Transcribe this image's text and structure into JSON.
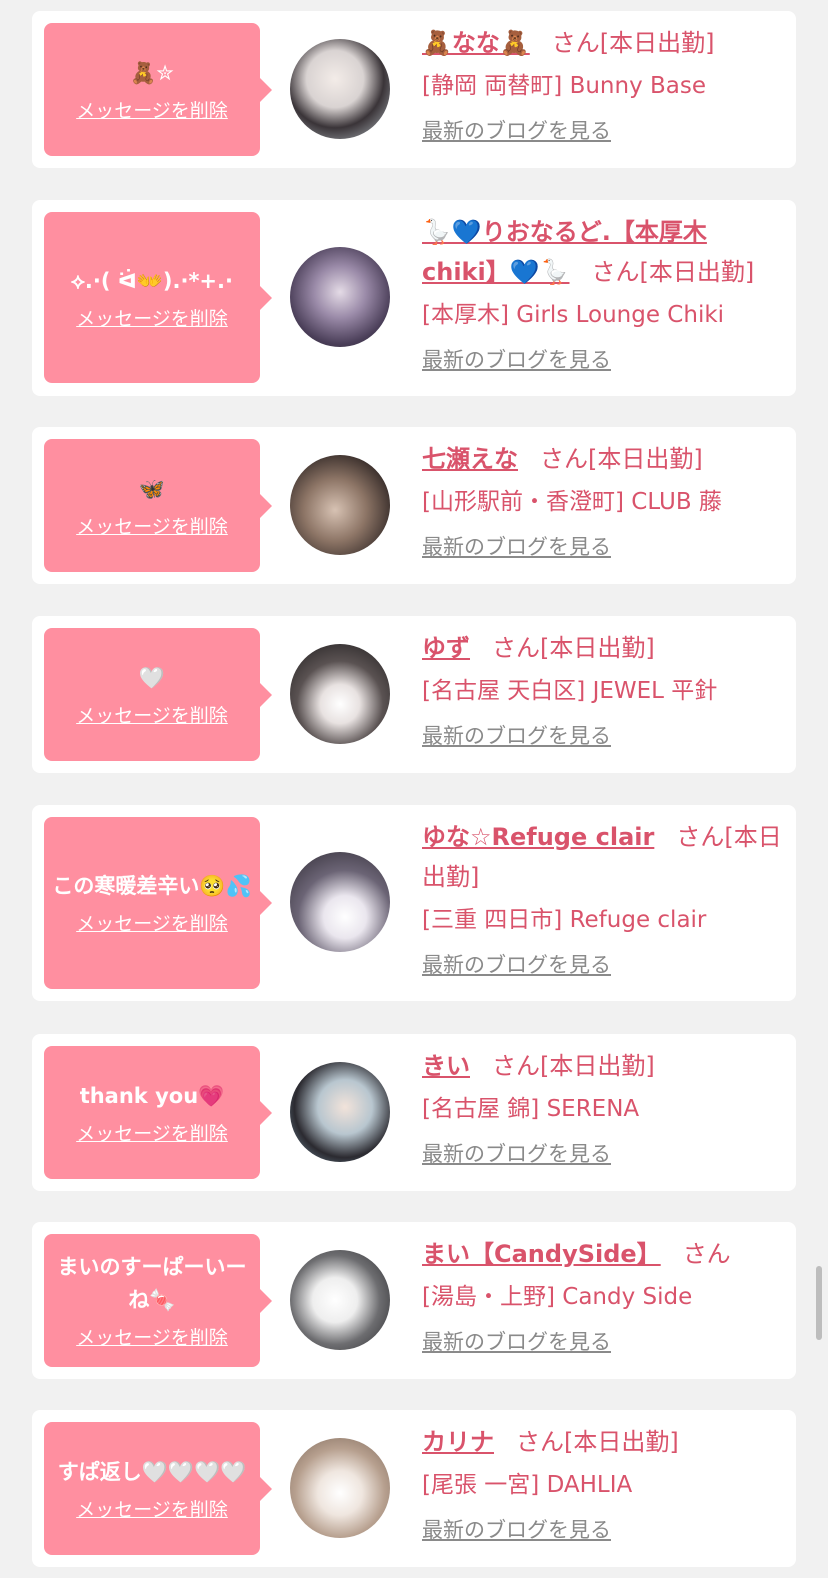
{
  "delete_label": "メッセージを削除",
  "blog_label": "最新のブログを見る",
  "san_label": "さん",
  "colors": {
    "accent": "#ff8fa0",
    "name": "#d9536b",
    "link_gray": "#8a8a8a"
  },
  "items": [
    {
      "message": "🧸✮",
      "name": "🧸なな🧸",
      "status": "[本日出勤]",
      "shop": "[静岡 両替町] Bunny Base",
      "avatar": "profile-photo"
    },
    {
      "message": "⟡.·( ᐛ👐).·*+.·",
      "name": "🪿💙りおなるど.【本厚木chiki】💙🪿",
      "status": "[本日出勤]",
      "shop": "[本厚木] Girls Lounge Chiki",
      "avatar": "profile-photo"
    },
    {
      "message": "🦋",
      "name": "七瀬えな",
      "status": "[本日出勤]",
      "shop": "[山形駅前・香澄町] CLUB 藤",
      "avatar": "profile-photo"
    },
    {
      "message": "🤍",
      "name": "ゆず",
      "status": "[本日出勤]",
      "shop": "[名古屋 天白区] JEWEL 平針",
      "avatar": "profile-photo"
    },
    {
      "message": "この寒暖差辛い🥺💦",
      "name": "ゆな☆Refuge clair",
      "status": "[本日出勤]",
      "shop": "[三重 四日市] Refuge clair",
      "avatar": "profile-photo"
    },
    {
      "message": "thank you💗",
      "name": "きい",
      "status": "[本日出勤]",
      "shop": "[名古屋 錦] SERENA",
      "avatar": "profile-photo"
    },
    {
      "message": "まいのすーぱーいーね🍬",
      "name": "まい【CandySide】",
      "status": "",
      "shop": "[湯島・上野] Candy Side",
      "avatar": "profile-photo"
    },
    {
      "message": "すぱ返し🤍🤍🤍🤍",
      "name": "カリナ",
      "status": "[本日出勤]",
      "shop": "[尾張 一宮] DAHLIA",
      "avatar": "profile-photo"
    }
  ]
}
